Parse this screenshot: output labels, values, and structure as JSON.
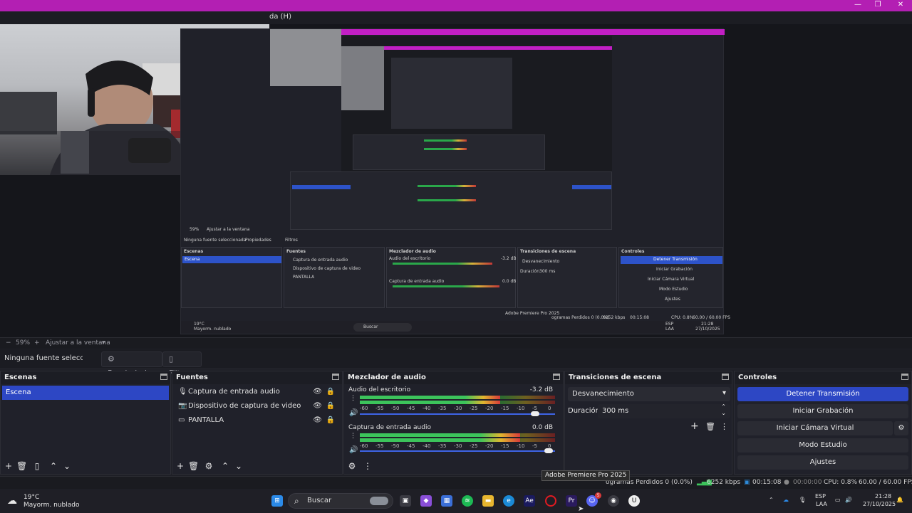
{
  "window": {
    "menu_fragment": "da (H)",
    "controls": {
      "minimize": "—",
      "maximize": "❐",
      "close": "✕"
    }
  },
  "preview": {
    "nested": {
      "title": "ada (H)",
      "source_label": "Ninguna fuente seleccionada",
      "propiedades": "Propiedades",
      "filtros": "Filtros",
      "zoom": "59%",
      "fit": "Ajustar a la ventana",
      "escenas": "Escenas",
      "escena": "Escena",
      "fuentes": "Fuentes",
      "fuentes_items": [
        "Captura de entrada audio",
        "Dispositivo de captura de video",
        "PANTALLA"
      ],
      "mezclador": "Mezclador de audio",
      "audio1": "Audio del escritorio",
      "audio1_db": "-3.2 dB",
      "audio2": "Captura de entrada audio",
      "audio2_db": "0.0 dB",
      "transiciones": "Transiciones de escena",
      "trans_value": "Desvanecimiento",
      "duracion": "Duración",
      "duracion_val": "300 ms",
      "controles": "Controles",
      "ctrl_buttons": [
        "Detener Transmisión",
        "Iniciar Grabación",
        "Iniciar Cámara Virtual",
        "Modo Estudio",
        "Ajustes"
      ],
      "tooltip": "Adobe Premiere Pro 2025",
      "status": "ogramas Perdidos 0 (0.0%)",
      "kbps": "6252 kbps",
      "time": "00:15:08",
      "cpu": "CPU: 0.8%",
      "fps": "60.00 / 60.00 FPS",
      "weather_temp": "19°C",
      "weather_desc": "Mayorm. nublado",
      "search": "Buscar",
      "lang": "ESP",
      "lang2": "LAA",
      "clock_time": "21:28",
      "clock_date": "27/10/2025"
    }
  },
  "zoombar": {
    "minus": "−",
    "zoom": "59%",
    "plus": "+",
    "fit": "Ajustar a la ventana",
    "caret": "▾"
  },
  "sourcebar": {
    "no_selection": "Ninguna fuente seleccionada",
    "properties": "Propiedades",
    "filters": "Filtros"
  },
  "scenes": {
    "title": "Escenas",
    "items": [
      "Escena"
    ]
  },
  "sources": {
    "title": "Fuentes",
    "items": [
      "Captura de entrada audio",
      "Dispositivo de captura de video",
      "PANTALLA"
    ]
  },
  "mixer": {
    "title": "Mezclador de audio",
    "channels": [
      {
        "name": "Audio del escritorio",
        "db": "-3.2 dB",
        "level": 0.72,
        "volume": 0.92
      },
      {
        "name": "Captura de entrada audio",
        "db": "0.0 dB",
        "level": 0.82,
        "volume": 0.99
      }
    ],
    "scale": [
      "-60",
      "-55",
      "-50",
      "-45",
      "-40",
      "-35",
      "-30",
      "-25",
      "-20",
      "-15",
      "-10",
      "-5",
      "0"
    ]
  },
  "transitions": {
    "title": "Transiciones de escena",
    "selected": "Desvanecimiento",
    "duration_label": "Duración",
    "duration_value": "300 ms"
  },
  "controls": {
    "title": "Controles",
    "stop_stream": "Detener Transmisión",
    "start_recording": "Iniciar Grabación",
    "start_virtual_cam": "Iniciar Cámara Virtual",
    "studio_mode": "Modo Estudio",
    "settings": "Ajustes"
  },
  "tooltip": "Adobe Premiere Pro 2025",
  "status": {
    "dropped": "ogramas Perdidos 0 (0.0%)",
    "bitrate": "6252 kbps",
    "live_time": "00:15:08",
    "rec_time": "00:00:00",
    "cpu": "CPU: 0.8%",
    "fps": "60.00 / 60.00 FPS"
  },
  "taskbar": {
    "weather_temp": "19°C",
    "weather_desc": "Mayorm. nublado",
    "search_label": "Buscar",
    "lang": "ESP",
    "lang_sub": "LAA",
    "time": "21:28",
    "date": "27/10/2025",
    "discord_badge": "5",
    "apps": [
      "windows-start",
      "task-view",
      "copilot",
      "store",
      "spotify",
      "file-explorer",
      "edge",
      "after-effects",
      "opera",
      "premiere-pro",
      "discord",
      "obs",
      "unreal"
    ],
    "colors": {
      "spotify": "#1db954",
      "premiere": "#2a1a5e",
      "after_effects": "#1a1a5e",
      "opera": "#e01b22",
      "edge": "#1b8ad6",
      "discord": "#5865f2"
    }
  },
  "colors": {
    "accent": "#2d47c4",
    "titlebar": "#b31fb3",
    "panel": "#20212a"
  }
}
